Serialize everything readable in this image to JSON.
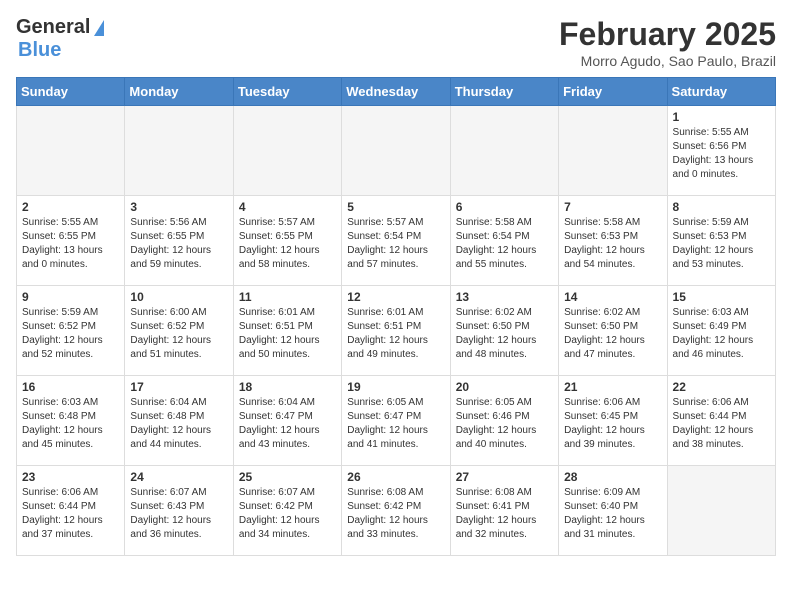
{
  "header": {
    "logo_general": "General",
    "logo_blue": "Blue",
    "month_title": "February 2025",
    "location": "Morro Agudo, Sao Paulo, Brazil"
  },
  "weekdays": [
    "Sunday",
    "Monday",
    "Tuesday",
    "Wednesday",
    "Thursday",
    "Friday",
    "Saturday"
  ],
  "weeks": [
    [
      {
        "day": "",
        "detail": ""
      },
      {
        "day": "",
        "detail": ""
      },
      {
        "day": "",
        "detail": ""
      },
      {
        "day": "",
        "detail": ""
      },
      {
        "day": "",
        "detail": ""
      },
      {
        "day": "",
        "detail": ""
      },
      {
        "day": "1",
        "detail": "Sunrise: 5:55 AM\nSunset: 6:56 PM\nDaylight: 13 hours\nand 0 minutes."
      }
    ],
    [
      {
        "day": "2",
        "detail": "Sunrise: 5:55 AM\nSunset: 6:55 PM\nDaylight: 13 hours\nand 0 minutes."
      },
      {
        "day": "3",
        "detail": "Sunrise: 5:56 AM\nSunset: 6:55 PM\nDaylight: 12 hours\nand 59 minutes."
      },
      {
        "day": "4",
        "detail": "Sunrise: 5:57 AM\nSunset: 6:55 PM\nDaylight: 12 hours\nand 58 minutes."
      },
      {
        "day": "5",
        "detail": "Sunrise: 5:57 AM\nSunset: 6:54 PM\nDaylight: 12 hours\nand 57 minutes."
      },
      {
        "day": "6",
        "detail": "Sunrise: 5:58 AM\nSunset: 6:54 PM\nDaylight: 12 hours\nand 55 minutes."
      },
      {
        "day": "7",
        "detail": "Sunrise: 5:58 AM\nSunset: 6:53 PM\nDaylight: 12 hours\nand 54 minutes."
      },
      {
        "day": "8",
        "detail": "Sunrise: 5:59 AM\nSunset: 6:53 PM\nDaylight: 12 hours\nand 53 minutes."
      }
    ],
    [
      {
        "day": "9",
        "detail": "Sunrise: 5:59 AM\nSunset: 6:52 PM\nDaylight: 12 hours\nand 52 minutes."
      },
      {
        "day": "10",
        "detail": "Sunrise: 6:00 AM\nSunset: 6:52 PM\nDaylight: 12 hours\nand 51 minutes."
      },
      {
        "day": "11",
        "detail": "Sunrise: 6:01 AM\nSunset: 6:51 PM\nDaylight: 12 hours\nand 50 minutes."
      },
      {
        "day": "12",
        "detail": "Sunrise: 6:01 AM\nSunset: 6:51 PM\nDaylight: 12 hours\nand 49 minutes."
      },
      {
        "day": "13",
        "detail": "Sunrise: 6:02 AM\nSunset: 6:50 PM\nDaylight: 12 hours\nand 48 minutes."
      },
      {
        "day": "14",
        "detail": "Sunrise: 6:02 AM\nSunset: 6:50 PM\nDaylight: 12 hours\nand 47 minutes."
      },
      {
        "day": "15",
        "detail": "Sunrise: 6:03 AM\nSunset: 6:49 PM\nDaylight: 12 hours\nand 46 minutes."
      }
    ],
    [
      {
        "day": "16",
        "detail": "Sunrise: 6:03 AM\nSunset: 6:48 PM\nDaylight: 12 hours\nand 45 minutes."
      },
      {
        "day": "17",
        "detail": "Sunrise: 6:04 AM\nSunset: 6:48 PM\nDaylight: 12 hours\nand 44 minutes."
      },
      {
        "day": "18",
        "detail": "Sunrise: 6:04 AM\nSunset: 6:47 PM\nDaylight: 12 hours\nand 43 minutes."
      },
      {
        "day": "19",
        "detail": "Sunrise: 6:05 AM\nSunset: 6:47 PM\nDaylight: 12 hours\nand 41 minutes."
      },
      {
        "day": "20",
        "detail": "Sunrise: 6:05 AM\nSunset: 6:46 PM\nDaylight: 12 hours\nand 40 minutes."
      },
      {
        "day": "21",
        "detail": "Sunrise: 6:06 AM\nSunset: 6:45 PM\nDaylight: 12 hours\nand 39 minutes."
      },
      {
        "day": "22",
        "detail": "Sunrise: 6:06 AM\nSunset: 6:44 PM\nDaylight: 12 hours\nand 38 minutes."
      }
    ],
    [
      {
        "day": "23",
        "detail": "Sunrise: 6:06 AM\nSunset: 6:44 PM\nDaylight: 12 hours\nand 37 minutes."
      },
      {
        "day": "24",
        "detail": "Sunrise: 6:07 AM\nSunset: 6:43 PM\nDaylight: 12 hours\nand 36 minutes."
      },
      {
        "day": "25",
        "detail": "Sunrise: 6:07 AM\nSunset: 6:42 PM\nDaylight: 12 hours\nand 34 minutes."
      },
      {
        "day": "26",
        "detail": "Sunrise: 6:08 AM\nSunset: 6:42 PM\nDaylight: 12 hours\nand 33 minutes."
      },
      {
        "day": "27",
        "detail": "Sunrise: 6:08 AM\nSunset: 6:41 PM\nDaylight: 12 hours\nand 32 minutes."
      },
      {
        "day": "28",
        "detail": "Sunrise: 6:09 AM\nSunset: 6:40 PM\nDaylight: 12 hours\nand 31 minutes."
      },
      {
        "day": "",
        "detail": ""
      }
    ]
  ]
}
